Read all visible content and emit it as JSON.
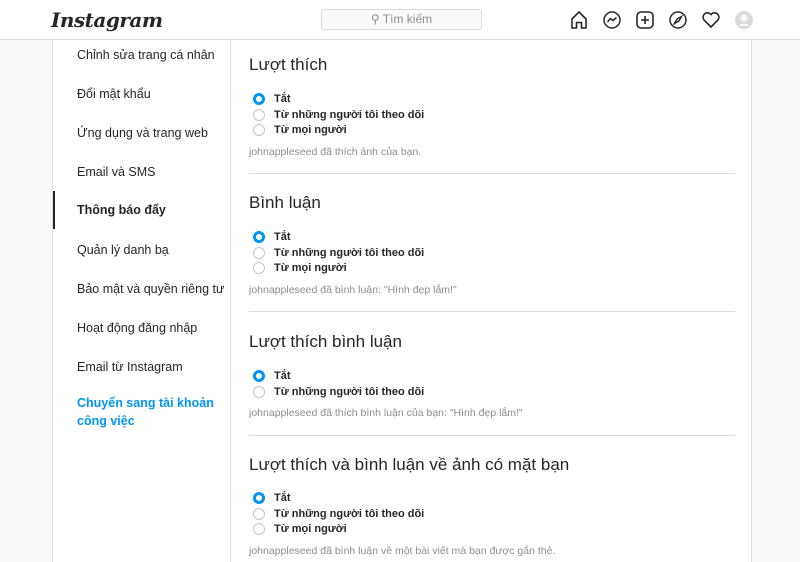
{
  "header": {
    "logo": "Instagram",
    "search_placeholder": "Tìm kiếm"
  },
  "icons": [
    "home-icon",
    "messenger-icon",
    "new-post-icon",
    "explore-icon",
    "activity-heart-icon",
    "avatar"
  ],
  "sidebar": {
    "items": [
      "Chỉnh sửa trang cá nhân",
      "Đổi mật khẩu",
      "Ứng dụng và trang web",
      "Email và SMS",
      "Thông báo đẩy",
      "Quản lý danh bạ",
      "Bảo mật và quyền riêng tư",
      "Hoạt động đăng nhập",
      "Email từ Instagram"
    ],
    "active": "Thông báo đẩy",
    "switch_line1": "Chuyển sang tài khoản",
    "switch_line2": "công việc"
  },
  "sections": [
    {
      "title": "Lượt thích",
      "options": [
        "Tắt",
        "Từ những người tôi theo dõi",
        "Từ mọi người"
      ],
      "selected": 0,
      "desc": "johnappleseed đã thích ảnh của bạn."
    },
    {
      "title": "Bình luận",
      "options": [
        "Tắt",
        "Từ những người tôi theo dõi",
        "Từ mọi người"
      ],
      "selected": 0,
      "desc": "johnappleseed đã bình luận: \"Hình đẹp lắm!\""
    },
    {
      "title": "Lượt thích bình luận",
      "options": [
        "Tắt",
        "Từ những người tôi theo dõi"
      ],
      "selected": 0,
      "desc": "johnappleseed đã thích bình luận của bạn: \"Hình đẹp lắm!\""
    },
    {
      "title": "Lượt thích và bình luận về ảnh có mặt bạn",
      "options": [
        "Tắt",
        "Từ những người tôi theo dõi",
        "Từ mọi người"
      ],
      "selected": 0,
      "desc": "johnappleseed đã bình luận về một bài viết mà bạn được gắn thẻ."
    }
  ]
}
